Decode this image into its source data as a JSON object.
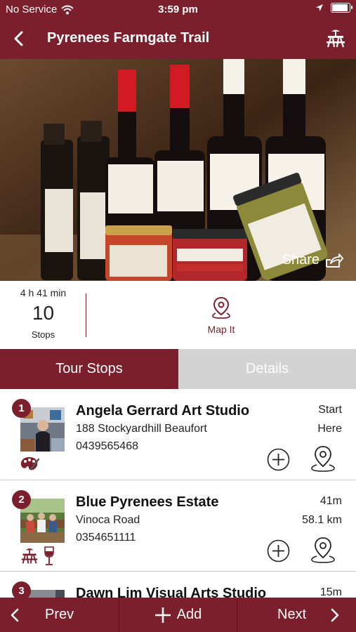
{
  "status_bar": {
    "carrier": "No Service",
    "time": "3:59 pm"
  },
  "nav": {
    "title": "Pyrenees Farmgate Trail"
  },
  "hero": {
    "share_label": "Share"
  },
  "summary": {
    "duration": "4 h 41 min",
    "stops_count": "10",
    "stops_label": "Stops",
    "map_label": "Map It"
  },
  "tabs": [
    {
      "label": "Tour Stops",
      "active": true
    },
    {
      "label": "Details",
      "active": false
    }
  ],
  "stops": [
    {
      "number": "1",
      "name": "Angela Gerrard Art Studio",
      "address": "188 Stockyardhill Beaufort",
      "phone": "0439565468",
      "dist_line1": "Start",
      "dist_line2": "Here",
      "categories": [
        "palette-icon"
      ]
    },
    {
      "number": "2",
      "name": "Blue Pyrenees Estate",
      "address": "Vinoca Road",
      "phone": "0354651111",
      "dist_line1": "41m",
      "dist_line2": "58.1 km",
      "categories": [
        "picnic-table-icon",
        "wine-glass-icon"
      ]
    },
    {
      "number": "3",
      "name": "Dawn Lim Visual Arts Studio",
      "address": "",
      "phone": "",
      "dist_line1": "15m",
      "dist_line2": "",
      "categories": []
    }
  ],
  "bottom_bar": {
    "prev_label": "Prev",
    "add_label": "Add",
    "next_label": "Next"
  },
  "colors": {
    "brand": "#7a1f2b",
    "tab_inactive": "#d3d3d3"
  }
}
